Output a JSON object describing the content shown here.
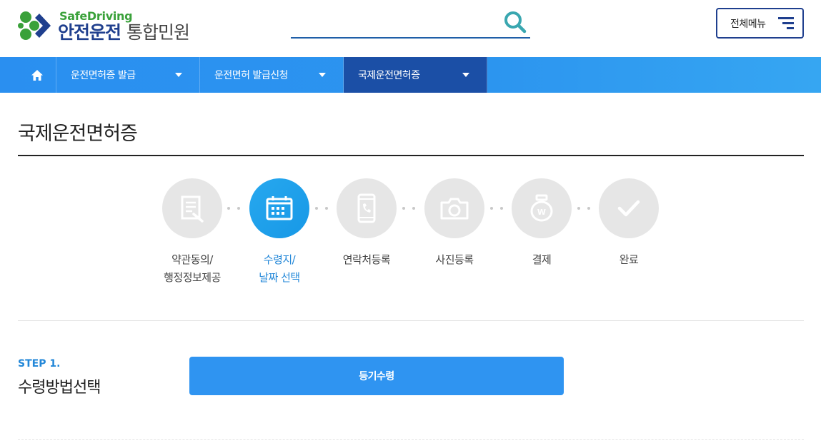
{
  "header": {
    "logo_en": "SafeDriving",
    "logo_ko_main": "안전운전",
    "logo_ko_sub": "통합민원",
    "search_placeholder": "",
    "menu_label": "전체메뉴"
  },
  "nav": {
    "items": [
      {
        "label": "운전면허증 발급"
      },
      {
        "label": "운전면허 발급신청"
      },
      {
        "label": "국제운전면허증"
      }
    ],
    "active_index": 2
  },
  "page": {
    "title": "국제운전면허증"
  },
  "steps": [
    {
      "line1": "약관동의/",
      "line2": "행정정보제공",
      "icon": "document-icon",
      "active": false
    },
    {
      "line1": "수령지/",
      "line2": "날짜 선택",
      "icon": "calendar-icon",
      "active": true
    },
    {
      "line1": "연락처등록",
      "line2": "",
      "icon": "phone-icon",
      "active": false
    },
    {
      "line1": "사진등록",
      "line2": "",
      "icon": "camera-icon",
      "active": false
    },
    {
      "line1": "결제",
      "line2": "",
      "icon": "payment-icon",
      "active": false
    },
    {
      "line1": "완료",
      "line2": "",
      "icon": "check-icon",
      "active": false
    }
  ],
  "section": {
    "step_no": "STEP 1.",
    "step_title": "수령방법선택",
    "button_label": "등기수령"
  },
  "colors": {
    "brand_blue": "#1f3f8e",
    "nav_blue": "#2a8ff0",
    "nav_active": "#1b4fa6",
    "accent_blue": "#2287d8",
    "logo_green": "#3aa13a"
  }
}
